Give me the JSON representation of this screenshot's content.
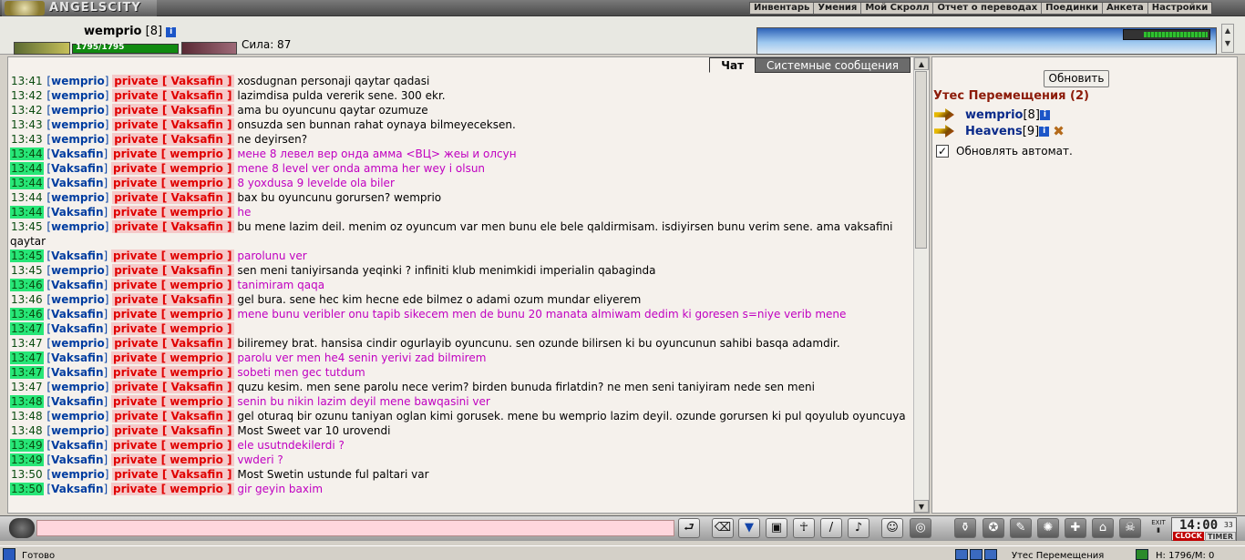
{
  "logo": {
    "title": "ANGELSCITY"
  },
  "menu": [
    "Инвентарь",
    "Умения",
    "Мой Скролл",
    "Отчет о переводах",
    "Поединки",
    "Анкета",
    "Настройки"
  ],
  "character": {
    "name": "wemprio",
    "level": "[8]",
    "hp": "1795/1795",
    "strength": "Сила: 87"
  },
  "chat": {
    "tabs": [
      "Чат",
      "Системные сообщения"
    ],
    "messages": [
      {
        "time": "13:41",
        "hl": false,
        "sender": "wemprio",
        "to": "private [ Vaksafin ]",
        "text": "xosdugnan personaji qaytar qadasi",
        "pink": false
      },
      {
        "time": "13:42",
        "hl": false,
        "sender": "wemprio",
        "to": "private [ Vaksafin ]",
        "text": "lazimdisa pulda vererik sene. 300 ekr.",
        "pink": false
      },
      {
        "time": "13:42",
        "hl": false,
        "sender": "wemprio",
        "to": "private [ Vaksafin ]",
        "text": "ama bu oyuncunu qaytar ozumuze",
        "pink": false
      },
      {
        "time": "13:43",
        "hl": false,
        "sender": "wemprio",
        "to": "private [ Vaksafin ]",
        "text": "onsuzda sen bunnan rahat oynaya bilmeyeceksen.",
        "pink": false
      },
      {
        "time": "13:43",
        "hl": false,
        "sender": "wemprio",
        "to": "private [ Vaksafin ]",
        "text": "ne deyirsen?",
        "pink": false
      },
      {
        "time": "13:44",
        "hl": true,
        "sender": "Vaksafin",
        "to": "private [ wemprio ]",
        "text": "мене 8 левел вер онда амма <ВЦ> жеы и олсун",
        "pink": true
      },
      {
        "time": "13:44",
        "hl": true,
        "sender": "Vaksafin",
        "to": "private [ wemprio ]",
        "text": "mene 8 level ver onda amma her wey i olsun",
        "pink": true
      },
      {
        "time": "13:44",
        "hl": true,
        "sender": "Vaksafin",
        "to": "private [ wemprio ]",
        "text": "8 yoxdusa 9 levelde ola biler",
        "pink": true
      },
      {
        "time": "13:44",
        "hl": false,
        "sender": "wemprio",
        "to": "private [ Vaksafin ]",
        "text": "bax bu oyuncunu gorursen? wemprio",
        "pink": false
      },
      {
        "time": "13:44",
        "hl": true,
        "sender": "Vaksafin",
        "to": "private [ wemprio ]",
        "text": "he",
        "pink": true
      },
      {
        "time": "13:45",
        "hl": false,
        "sender": "wemprio",
        "to": "private [ Vaksafin ]",
        "text": "bu mene lazim deil. menim oz oyuncum var men bunu ele bele qaldirmisam. isdiyirsen bunu verim sene. ama vaksafini qaytar",
        "pink": false
      },
      {
        "time": "13:45",
        "hl": true,
        "sender": "Vaksafin",
        "to": "private [ wemprio ]",
        "text": "parolunu ver",
        "pink": true
      },
      {
        "time": "13:45",
        "hl": false,
        "sender": "wemprio",
        "to": "private [ Vaksafin ]",
        "text": "sen meni taniyirsanda yeqinki ? infiniti klub menimkidi imperialin qabaginda",
        "pink": false
      },
      {
        "time": "13:46",
        "hl": true,
        "sender": "Vaksafin",
        "to": "private [ wemprio ]",
        "text": "tanimiram qaqa",
        "pink": true
      },
      {
        "time": "13:46",
        "hl": false,
        "sender": "wemprio",
        "to": "private [ Vaksafin ]",
        "text": "gel bura. sene hec kim hecne ede bilmez o adami ozum mundar eliyerem",
        "pink": false
      },
      {
        "time": "13:46",
        "hl": true,
        "sender": "Vaksafin",
        "to": "private [ wemprio ]",
        "text": "mene bunu veribler onu tapib sikecem men de bunu 20 manata almiwam dedim ki goresen s=niye verib mene",
        "pink": true
      },
      {
        "time": "13:47",
        "hl": true,
        "sender": "Vaksafin",
        "to": "private [ wemprio ]",
        "text": "",
        "pink": true
      },
      {
        "time": "13:47",
        "hl": false,
        "sender": "wemprio",
        "to": "private [ Vaksafin ]",
        "text": "biliremey brat. hansisa cindir ogurlayib oyuncunu. sen ozunde bilirsen ki bu oyuncunun sahibi basqa adamdir.",
        "pink": false
      },
      {
        "time": "13:47",
        "hl": true,
        "sender": "Vaksafin",
        "to": "private [ wemprio ]",
        "text": "parolu ver men he4 senin yerivi zad bilmirem",
        "pink": true
      },
      {
        "time": "13:47",
        "hl": true,
        "sender": "Vaksafin",
        "to": "private [ wemprio ]",
        "text": "sobeti men gec tutdum",
        "pink": true
      },
      {
        "time": "13:47",
        "hl": false,
        "sender": "wemprio",
        "to": "private [ Vaksafin ]",
        "text": "quzu kesim. men sene parolu nece verim? birden bunuda firlatdin? ne men seni taniyiram nede sen meni",
        "pink": false
      },
      {
        "time": "13:48",
        "hl": true,
        "sender": "Vaksafin",
        "to": "private [ wemprio ]",
        "text": "senin bu nikin lazim deyil mene bawqasini ver",
        "pink": true
      },
      {
        "time": "13:48",
        "hl": false,
        "sender": "wemprio",
        "to": "private [ Vaksafin ]",
        "text": "gel oturaq bir ozunu taniyan oglan kimi gorusek. mene bu wemprio lazim deyil. ozunde gorursen ki pul qoyulub oyuncuya",
        "pink": false
      },
      {
        "time": "13:48",
        "hl": false,
        "sender": "wemprio",
        "to": "private [ Vaksafin ]",
        "text": "Most Sweet var 10 urovendi",
        "pink": false
      },
      {
        "time": "13:49",
        "hl": true,
        "sender": "Vaksafin",
        "to": "private [ wemprio ]",
        "text": "ele usutndekilerdi ?",
        "pink": true
      },
      {
        "time": "13:49",
        "hl": true,
        "sender": "Vaksafin",
        "to": "private [ wemprio ]",
        "text": "vwderi ?",
        "pink": true
      },
      {
        "time": "13:50",
        "hl": false,
        "sender": "wemprio",
        "to": "private [ Vaksafin ]",
        "text": "Most Swetin ustunde ful paltari var",
        "pink": false
      },
      {
        "time": "13:50",
        "hl": true,
        "sender": "Vaksafin",
        "to": "private [ wemprio ]",
        "text": "gir geyin baxim",
        "pink": true
      }
    ]
  },
  "right": {
    "refresh_label": "Обновить",
    "location_title": "Утес Перемещения (2)",
    "users": [
      {
        "name": "wemprio",
        "level": "[8]",
        "x": false
      },
      {
        "name": "Heavens",
        "level": "[9]",
        "x": true
      }
    ],
    "auto_label": "Обновлять автомат."
  },
  "bottom": {
    "input_value": "",
    "clock_time": "14:00",
    "clock_seconds": "33",
    "clock_label": "CLOCK",
    "timer_label": "TIMER",
    "exit_label": "EXIT"
  },
  "status": {
    "text": "Готово",
    "location": "Утес Перемещения",
    "hp": "H: 1796/M: 0"
  }
}
